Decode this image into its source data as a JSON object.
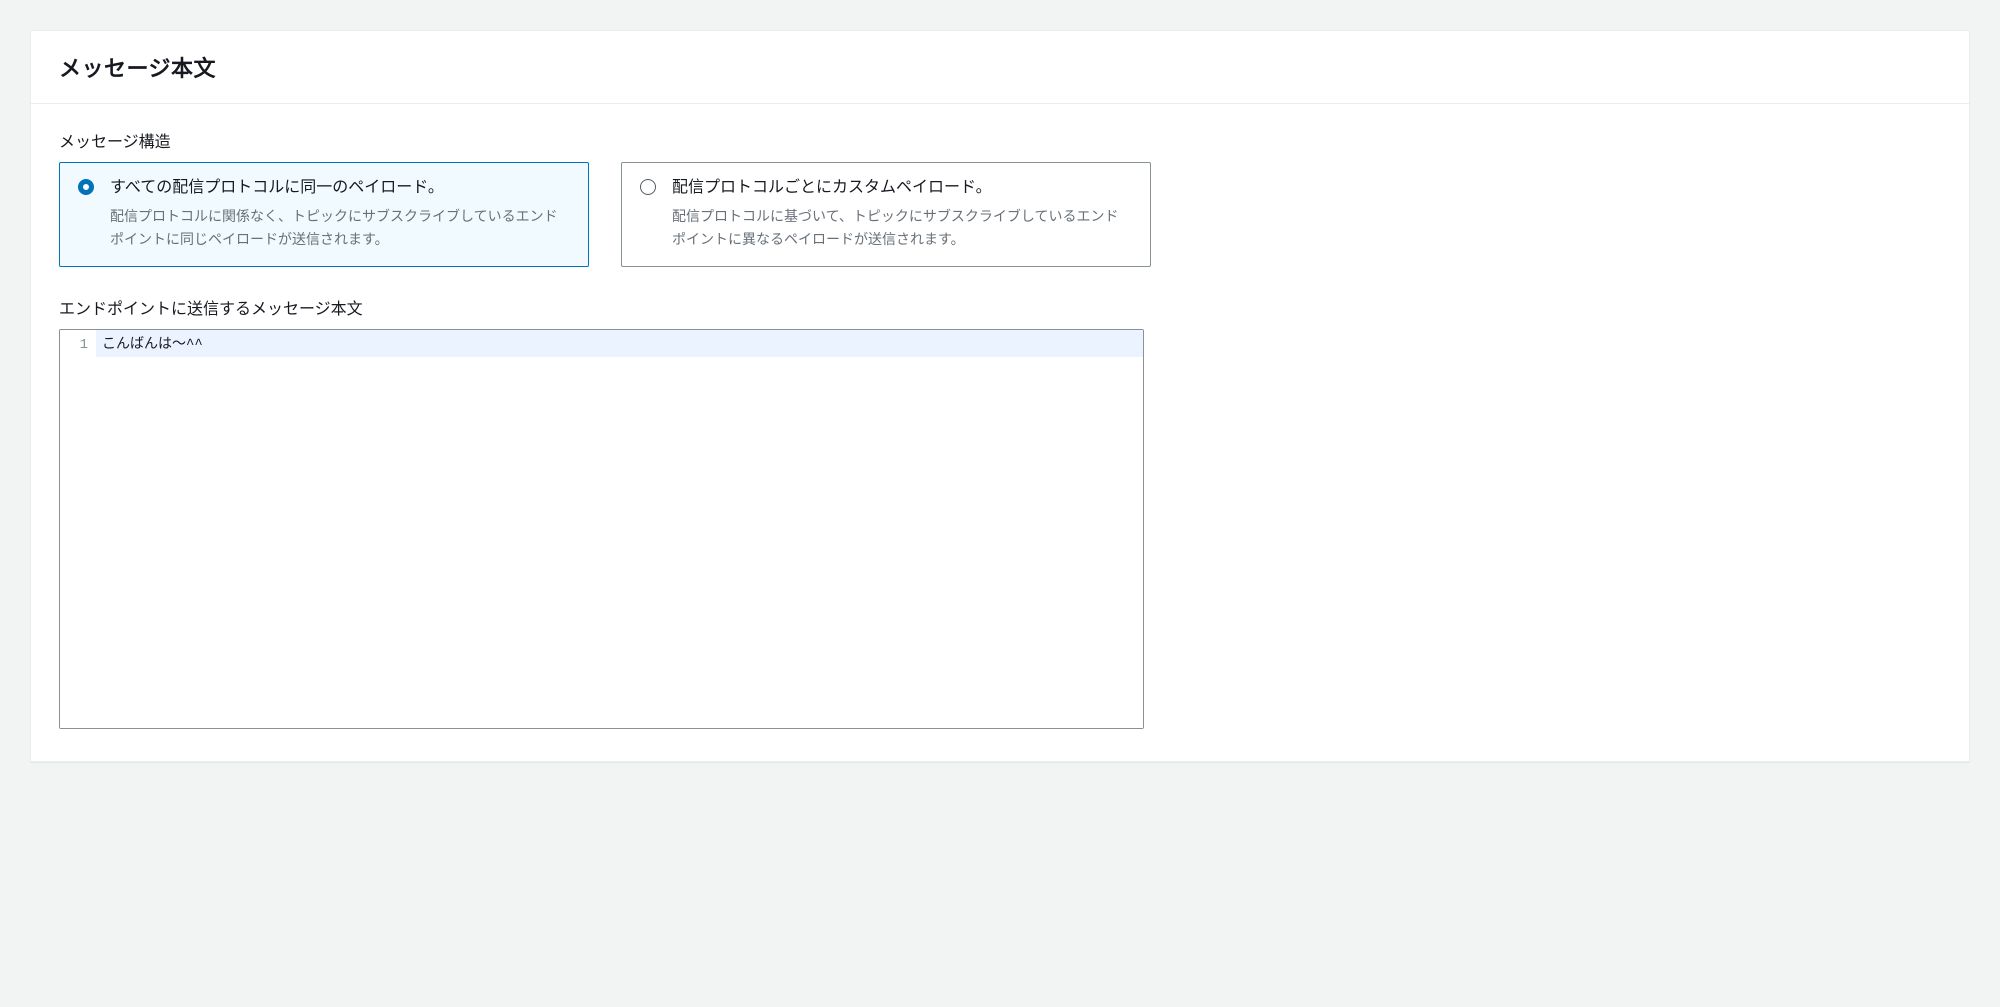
{
  "panel": {
    "title": "メッセージ本文"
  },
  "structure": {
    "label": "メッセージ構造",
    "options": [
      {
        "title": "すべての配信プロトコルに同一のペイロード。",
        "description": "配信プロトコルに関係なく、トピックにサブスクライブしているエンドポイントに同じペイロードが送信されます。",
        "selected": true
      },
      {
        "title": "配信プロトコルごとにカスタムペイロード。",
        "description": "配信プロトコルに基づいて、トピックにサブスクライブしているエンドポイントに異なるペイロードが送信されます。",
        "selected": false
      }
    ]
  },
  "body": {
    "label": "エンドポイントに送信するメッセージ本文",
    "lineNumber": "1",
    "content": "こんばんは〜^^"
  }
}
